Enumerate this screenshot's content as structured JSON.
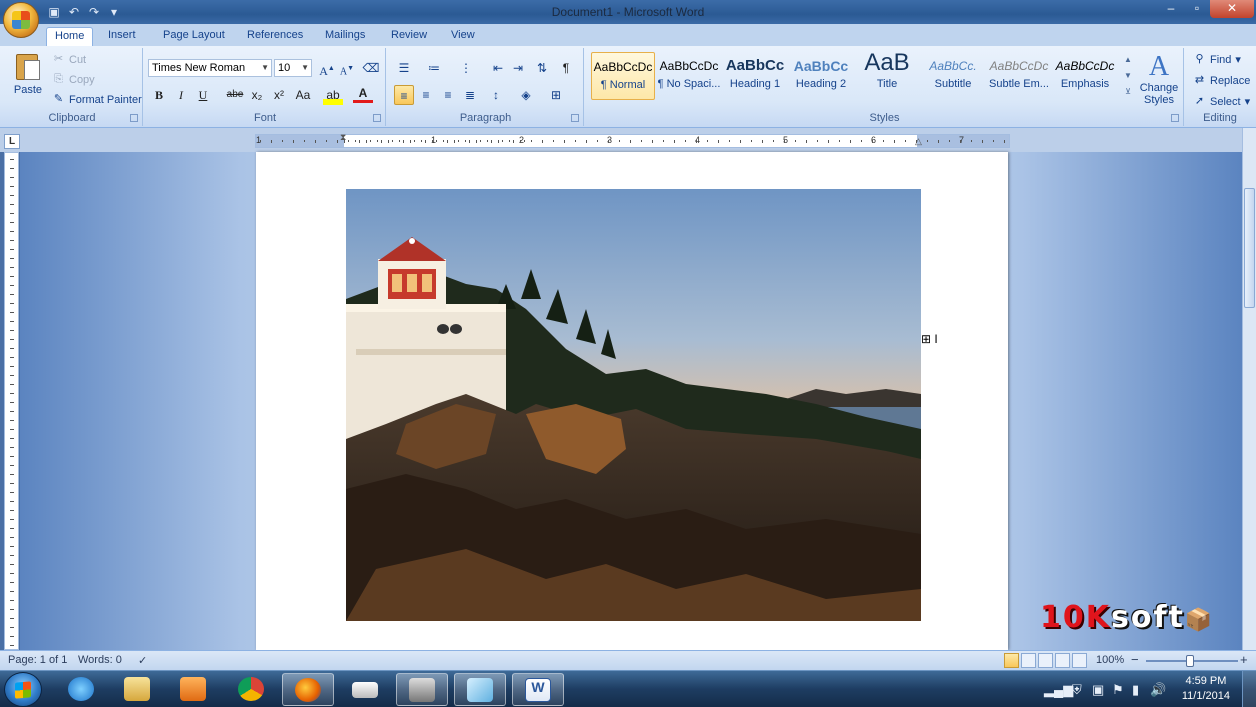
{
  "window": {
    "title": "Document1 - Microsoft Word",
    "controls": [
      "–",
      "▫",
      "✕"
    ]
  },
  "tabs": [
    "Home",
    "Insert",
    "Page Layout",
    "References",
    "Mailings",
    "Review",
    "View"
  ],
  "clipboard": {
    "paste_label": "Paste",
    "cut_label": "Cut",
    "copy_label": "Copy",
    "format_painter_label": "Format Painter",
    "group_label": "Clipboard"
  },
  "font": {
    "family": "Times New Roman",
    "size": "10",
    "grow": "A",
    "shrink": "A",
    "bold": "B",
    "italic": "I",
    "underline": "U",
    "strike": "abe",
    "subscript": "x₂",
    "superscript": "x²",
    "change_case": "Aa",
    "highlight": "ab",
    "font_color": "A",
    "group_label": "Font"
  },
  "paragraph": {
    "group_label": "Paragraph",
    "show_marks": "¶"
  },
  "styles": {
    "group_label": "Styles",
    "items": [
      {
        "sample": "AaBbCcDc",
        "name": "¶ Normal"
      },
      {
        "sample": "AaBbCcDc",
        "name": "¶ No Spaci..."
      },
      {
        "sample": "AaBbCc",
        "name": "Heading 1"
      },
      {
        "sample": "AaBbCc",
        "name": "Heading 2"
      },
      {
        "sample": "AaB",
        "name": "Title"
      },
      {
        "sample": "AaBbCc.",
        "name": "Subtitle"
      },
      {
        "sample": "AaBbCcDc",
        "name": "Subtle Em..."
      },
      {
        "sample": "AaBbCcDc",
        "name": "Emphasis"
      }
    ],
    "change_styles_label": "Change Styles"
  },
  "editing": {
    "group_label": "Editing",
    "find_label": "Find",
    "replace_label": "Replace",
    "select_label": "Select"
  },
  "ruler": {
    "corner": "L",
    "numbers": [
      "1",
      "1",
      "2",
      "3",
      "4",
      "5",
      "6",
      "7"
    ]
  },
  "status": {
    "page": "Page: 1 of 1",
    "words": "Words: 0",
    "zoom": "100%",
    "zoom_minus": "−",
    "zoom_plus": "+"
  },
  "watermark": {
    "red_text": "10K",
    "white_text": "soft"
  },
  "taskbar": {
    "time": "4:59 PM",
    "date": "11/1/2014"
  },
  "colors": {
    "accent": "#15428b",
    "ribbon": "#dbe8f9",
    "selected_style": "#fde7a8",
    "taskbar": "#1e3d62"
  }
}
